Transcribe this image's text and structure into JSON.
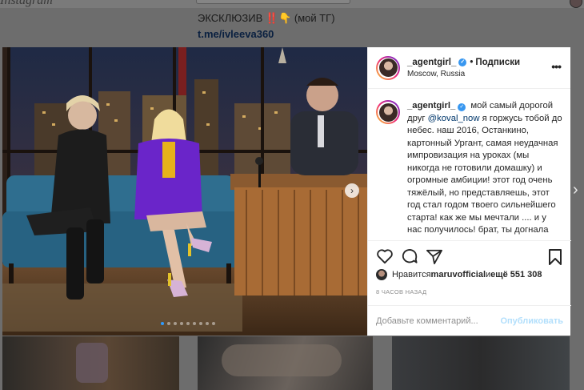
{
  "background": {
    "header_logo": "Instagram",
    "bio_line": "ЭКСКЛЮЗИВ ‼️👇 (мой ТГ)",
    "bio_link": "t.me/ivleeva360"
  },
  "post": {
    "author": "_agentgirl_",
    "follow_separator": "•",
    "follow_label": "Подписки",
    "location": "Moscow, Russia",
    "caption_author": "_agentgirl_",
    "caption_part1": " мой самый дорогой друг ",
    "caption_mention": "@koval_now",
    "caption_part2": " я горжусь тобой до небес. наш 2016, Останкино, картонный Ургант, самая неудачная импровизация на уроках (мы никогда не готовили домашку) и огромные амбиции! этот год очень тяжёлый, но представляешь, этот год стал годом твоего сильнейшего старта! как же мы мечтали .... и у нас получилось! брат, ты догнала меня так быстро! помнишь, как мы обе",
    "likes_prefix": "Нравится ",
    "likes_user": "maruvofficial",
    "likes_middle": " и ",
    "likes_count": "ещё 551 308",
    "timestamp": "8 ЧАСОВ НАЗАД",
    "comment_placeholder": "Добавьте комментарий...",
    "publish_label": "Опубликовать",
    "carousel_count": 9,
    "carousel_active": 0
  },
  "colors": {
    "accent": "#3897f0",
    "publish_disabled": "#b2dffc",
    "overlay": "#6d6d6d"
  },
  "icons": [
    "heart-icon",
    "comment-icon",
    "share-icon",
    "bookmark-icon",
    "more-icon",
    "verified-icon",
    "chevron-right-icon"
  ]
}
